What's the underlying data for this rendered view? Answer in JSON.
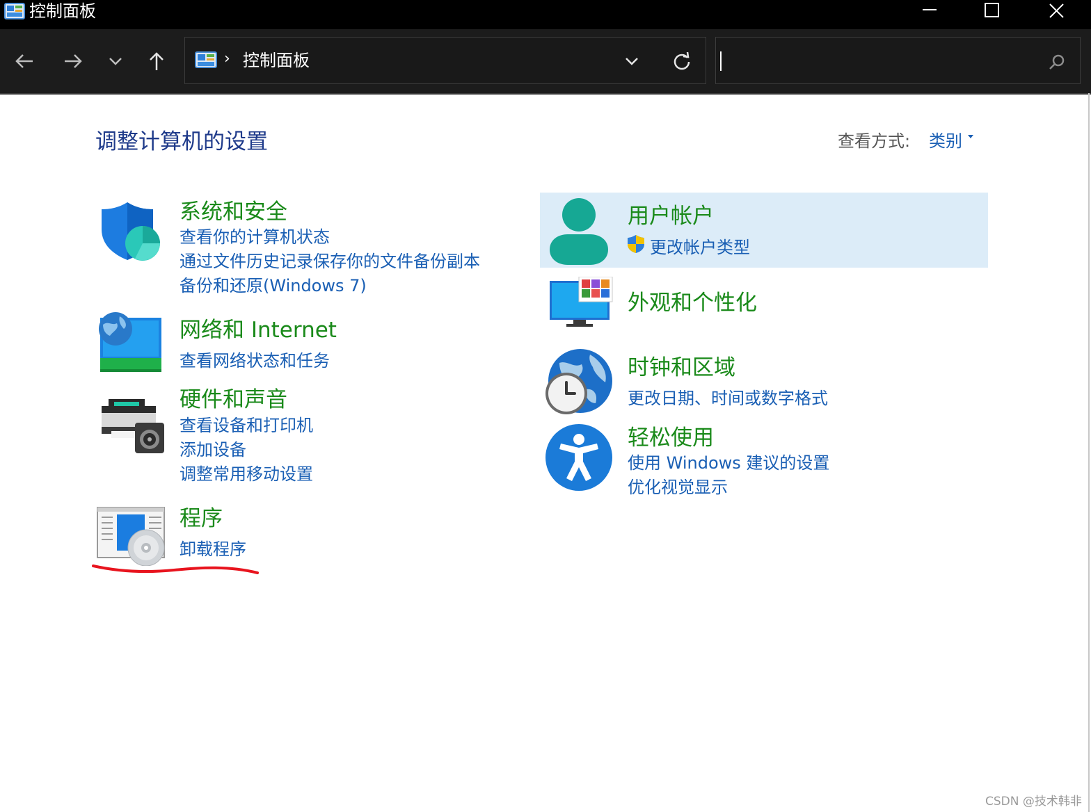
{
  "window": {
    "title": "控制面板"
  },
  "address_bar": {
    "separator": "›",
    "path": "控制面板"
  },
  "search": {
    "value": ""
  },
  "content": {
    "heading": "调整计算机的设置",
    "view_by_label": "查看方式:",
    "view_by_value": "类别"
  },
  "categories_left": [
    {
      "title": "系统和安全",
      "icon": "shield-icon",
      "links": [
        "查看你的计算机状态",
        "通过文件历史记录保存你的文件备份副本",
        "备份和还原(Windows 7)"
      ]
    },
    {
      "title": "网络和 Internet",
      "icon": "network-globe-icon",
      "links": [
        "查看网络状态和任务"
      ]
    },
    {
      "title": "硬件和声音",
      "icon": "printer-speaker-icon",
      "links": [
        "查看设备和打印机",
        "添加设备",
        "调整常用移动设置"
      ]
    },
    {
      "title": "程序",
      "icon": "programs-disc-icon",
      "links": [
        "卸载程序"
      ]
    }
  ],
  "categories_right": [
    {
      "title": "用户帐户",
      "icon": "user-icon",
      "links": [
        "更改帐户类型"
      ],
      "link_icon": "uac-shield-icon"
    },
    {
      "title": "外观和个性化",
      "icon": "monitor-palette-icon",
      "links": []
    },
    {
      "title": "时钟和区域",
      "icon": "clock-globe-icon",
      "links": [
        "更改日期、时间或数字格式"
      ]
    },
    {
      "title": "轻松使用",
      "icon": "accessibility-icon",
      "links": [
        "使用 Windows 建议的设置",
        "优化视觉显示"
      ]
    }
  ],
  "annotation": {
    "underline_color": "#e8141e"
  },
  "watermark": "CSDN @技术韩非",
  "colors": {
    "heading": "#1e3a8a",
    "category_title": "#1a8a1a",
    "link": "#1a5fb4",
    "highlight": "#dcecf8"
  }
}
